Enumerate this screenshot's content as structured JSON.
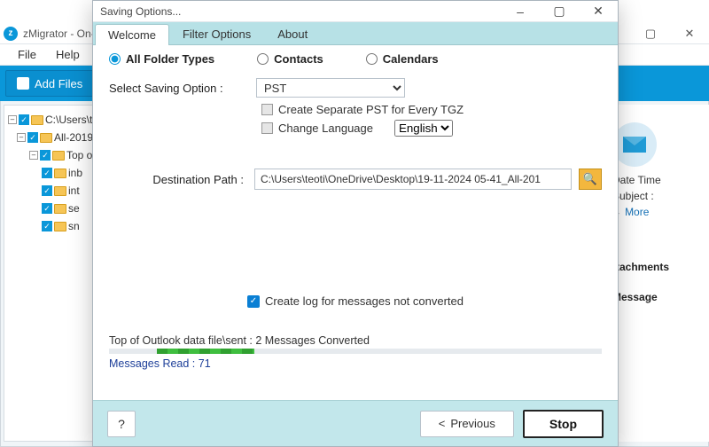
{
  "bg": {
    "title": "zMigrator - On-",
    "menu": {
      "file": "File",
      "help": "Help"
    },
    "toolbar": {
      "add_files": "Add Files"
    },
    "tree": {
      "root": "C:\\Users\\t",
      "n1": "All-2019",
      "n2": "Top o",
      "leaf": {
        "a": "inb",
        "b": "int",
        "c": "se",
        "d": "sn"
      }
    },
    "right": {
      "datetime": "Date Time",
      "subject": "Subject :",
      "more": "More",
      "tab_attach": "ttachments",
      "tab_message": "Message"
    },
    "winbtns": {
      "min": "–",
      "max": "▢",
      "close": "✕"
    }
  },
  "dialog": {
    "title": "Saving Options...",
    "winbtns": {
      "min": "–",
      "max": "▢",
      "close": "✕"
    },
    "tabs": {
      "welcome": "Welcome",
      "filter": "Filter Options",
      "about": "About"
    },
    "radios": {
      "all": "All Folder Types",
      "contacts": "Contacts",
      "calendars": "Calendars"
    },
    "saving_label": "Select Saving Option :",
    "saving_selected": "PST",
    "chk_separate": "Create Separate PST for Every TGZ",
    "chk_lang_label": "Change Language",
    "lang_selected": "English",
    "dest_label": "Destination Path :",
    "dest_value": "C:\\Users\\teoti\\OneDrive\\Desktop\\19-11-2024 05-41_All-201",
    "browse_icon": "🔍",
    "log_label": "Create log for messages not converted",
    "progress_text": "Top of Outlook data file\\sent : 2 Messages Converted",
    "messages_read": "Messages Read : 71",
    "footer": {
      "help": "?",
      "prev": "Previous",
      "prev_glyph": "<",
      "stop": "Stop"
    }
  }
}
